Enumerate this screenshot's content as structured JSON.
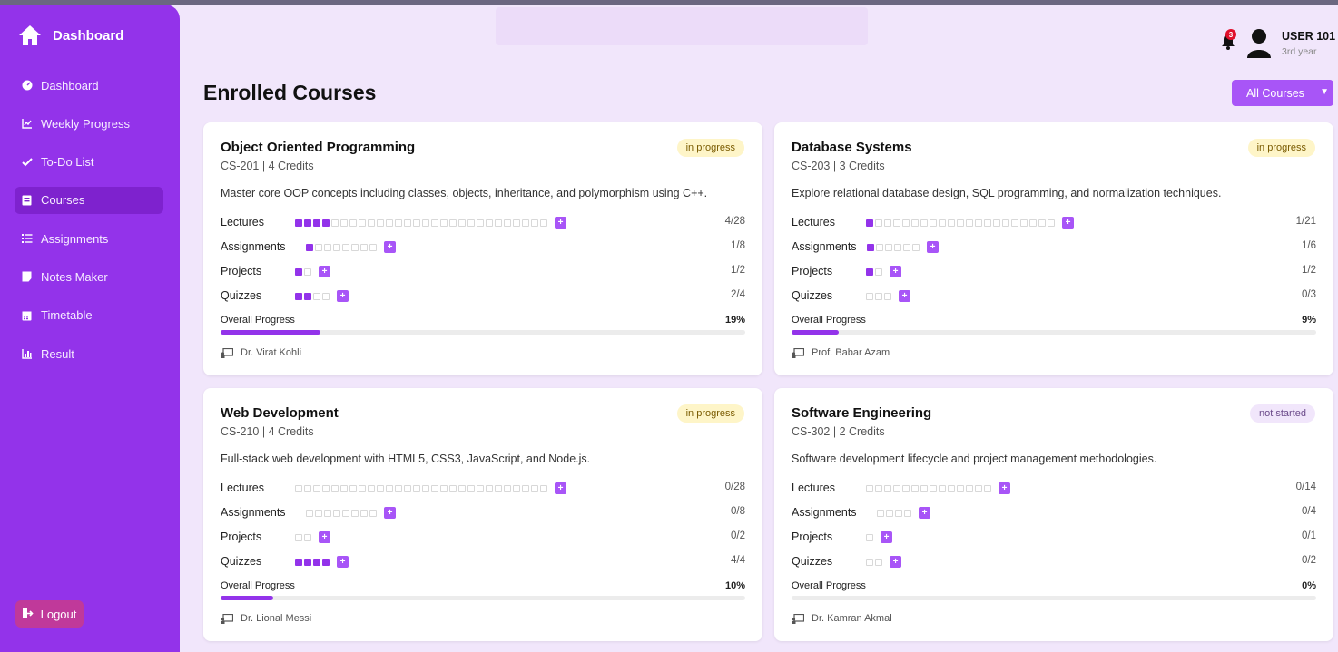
{
  "sidebar": {
    "brand": "Dashboard",
    "items": [
      {
        "label": "Dashboard",
        "icon": "gauge-icon",
        "active": false
      },
      {
        "label": "Weekly Progress",
        "icon": "line-chart-icon",
        "active": false
      },
      {
        "label": "To-Do List",
        "icon": "tasks-icon",
        "active": false
      },
      {
        "label": "Courses",
        "icon": "book-icon",
        "active": true
      },
      {
        "label": "Assignments",
        "icon": "list-icon",
        "active": false
      },
      {
        "label": "Notes Maker",
        "icon": "note-icon",
        "active": false
      },
      {
        "label": "Timetable",
        "icon": "calendar-icon",
        "active": false
      },
      {
        "label": "Result",
        "icon": "bar-chart-icon",
        "active": false
      }
    ],
    "logout": "Logout"
  },
  "header": {
    "notifications": "3",
    "user_name": "USER 101",
    "user_year": "3rd year"
  },
  "main": {
    "title": "Enrolled Courses",
    "filter": "All Courses"
  },
  "colors": {
    "accent": "#9333ea",
    "sidebar": "#9333ea",
    "background": "#f1e6fb"
  },
  "courses": [
    {
      "title": "Object Oriented Programming",
      "code": "CS-201 | 4 Credits",
      "status": "in progress",
      "status_type": "inprog",
      "description": "Master core OOP concepts including classes, objects, inheritance, and polymorphism using C++.",
      "metrics": [
        {
          "label": "Lectures",
          "done": 4,
          "total": 28,
          "count": "4/28"
        },
        {
          "label": "Assignments",
          "done": 1,
          "total": 8,
          "count": "1/8"
        },
        {
          "label": "Projects",
          "done": 1,
          "total": 2,
          "count": "1/2"
        },
        {
          "label": "Quizzes",
          "done": 2,
          "total": 4,
          "count": "2/4"
        }
      ],
      "overall_label": "Overall Progress",
      "overall": "19%",
      "overall_value": 19,
      "instructor": "Dr. Virat Kohli"
    },
    {
      "title": "Database Systems",
      "code": "CS-203 | 3 Credits",
      "status": "in progress",
      "status_type": "inprog",
      "description": "Explore relational database design, SQL programming, and normalization techniques.",
      "metrics": [
        {
          "label": "Lectures",
          "done": 1,
          "total": 21,
          "count": "1/21"
        },
        {
          "label": "Assignments",
          "done": 1,
          "total": 6,
          "count": "1/6"
        },
        {
          "label": "Projects",
          "done": 1,
          "total": 2,
          "count": "1/2"
        },
        {
          "label": "Quizzes",
          "done": 0,
          "total": 3,
          "count": "0/3"
        }
      ],
      "overall_label": "Overall Progress",
      "overall": "9%",
      "overall_value": 9,
      "instructor": "Prof. Babar Azam"
    },
    {
      "title": "Web Development",
      "code": "CS-210 | 4 Credits",
      "status": "in progress",
      "status_type": "inprog",
      "description": "Full-stack web development with HTML5, CSS3, JavaScript, and Node.js.",
      "metrics": [
        {
          "label": "Lectures",
          "done": 0,
          "total": 28,
          "count": "0/28"
        },
        {
          "label": "Assignments",
          "done": 0,
          "total": 8,
          "count": "0/8"
        },
        {
          "label": "Projects",
          "done": 0,
          "total": 2,
          "count": "0/2"
        },
        {
          "label": "Quizzes",
          "done": 4,
          "total": 4,
          "count": "4/4"
        }
      ],
      "overall_label": "Overall Progress",
      "overall": "10%",
      "overall_value": 10,
      "instructor": "Dr. Lional Messi"
    },
    {
      "title": "Software Engineering",
      "code": "CS-302 | 2 Credits",
      "status": "not started",
      "status_type": "notstarted",
      "description": "Software development lifecycle and project management methodologies.",
      "metrics": [
        {
          "label": "Lectures",
          "done": 0,
          "total": 14,
          "count": "0/14"
        },
        {
          "label": "Assignments",
          "done": 0,
          "total": 4,
          "count": "0/4"
        },
        {
          "label": "Projects",
          "done": 0,
          "total": 1,
          "count": "0/1"
        },
        {
          "label": "Quizzes",
          "done": 0,
          "total": 2,
          "count": "0/2"
        }
      ],
      "overall_label": "Overall Progress",
      "overall": "0%",
      "overall_value": 0,
      "instructor": "Dr. Kamran Akmal"
    }
  ]
}
